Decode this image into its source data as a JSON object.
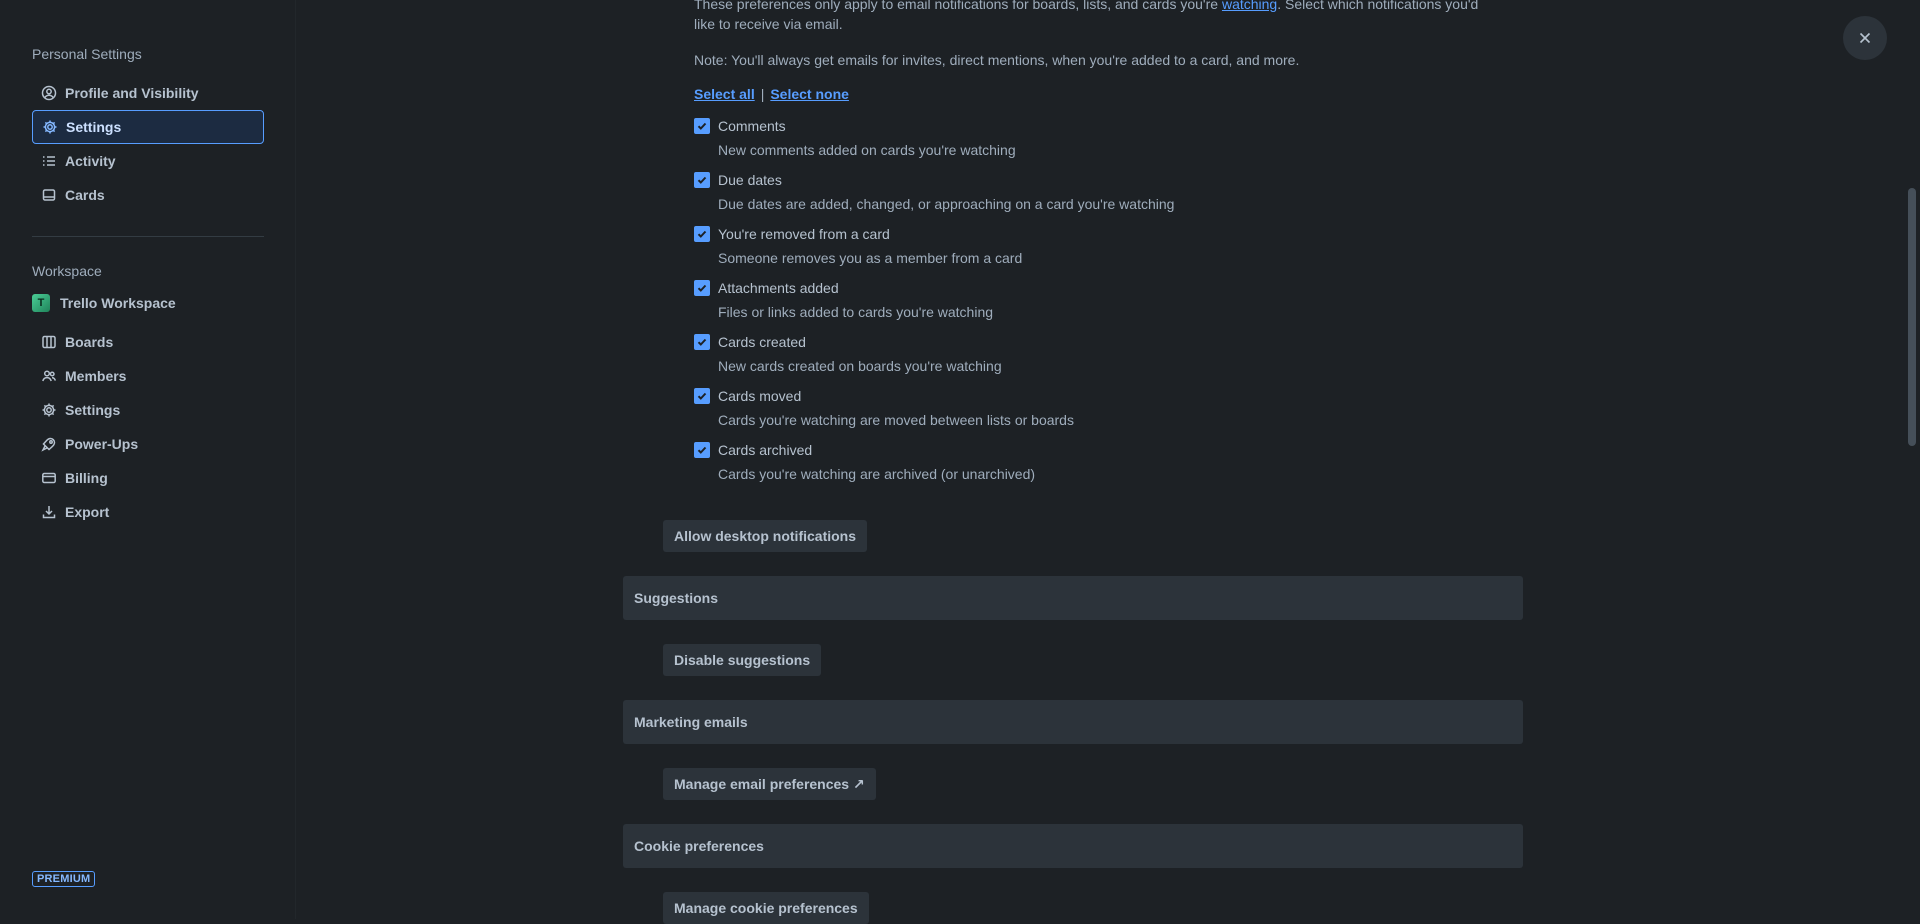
{
  "sidebar": {
    "personal_title": "Personal Settings",
    "personal_items": [
      {
        "label": "Profile and Visibility",
        "icon": "profile-icon"
      },
      {
        "label": "Settings",
        "icon": "gear-icon",
        "active": true
      },
      {
        "label": "Activity",
        "icon": "activity-list-icon"
      },
      {
        "label": "Cards",
        "icon": "card-icon"
      }
    ],
    "workspace_title": "Workspace",
    "workspace_name": "Trello Workspace",
    "workspace_avatar_letter": "T",
    "workspace_items": [
      {
        "label": "Boards",
        "icon": "boards-icon"
      },
      {
        "label": "Members",
        "icon": "members-icon"
      },
      {
        "label": "Settings",
        "icon": "gear-icon"
      },
      {
        "label": "Power-Ups",
        "icon": "rocket-icon"
      },
      {
        "label": "Billing",
        "icon": "billing-card-icon"
      },
      {
        "label": "Export",
        "icon": "export-icon"
      }
    ],
    "premium_badge": "PREMIUM"
  },
  "main": {
    "intro_line1_prefix": "These preferences only apply to email notifications for boards, lists, and cards you're ",
    "intro_link": "watching",
    "intro_line1_suffix": ". Select which notifications you'd",
    "intro_line2": "like to receive via email.",
    "note": "Note: You'll always get emails for invites, direct mentions, when you're added to a card, and more.",
    "select_all": "Select all",
    "separator": "|",
    "select_none": "Select none",
    "notifications": [
      {
        "title": "Comments",
        "desc": "New comments added on cards you're watching",
        "checked": true
      },
      {
        "title": "Due dates",
        "desc": "Due dates are added, changed, or approaching on a card you're watching",
        "checked": true
      },
      {
        "title": "You're removed from a card",
        "desc": "Someone removes you as a member from a card",
        "checked": true
      },
      {
        "title": "Attachments added",
        "desc": "Files or links added to cards you're watching",
        "checked": true
      },
      {
        "title": "Cards created",
        "desc": "New cards created on boards you're watching",
        "checked": true
      },
      {
        "title": "Cards moved",
        "desc": "Cards you're watching are moved between lists or boards",
        "checked": true
      },
      {
        "title": "Cards archived",
        "desc": "Cards you're watching are archived (or unarchived)",
        "checked": true
      }
    ],
    "desktop_button": "Allow desktop notifications",
    "suggestions_title": "Suggestions",
    "disable_suggestions_button": "Disable suggestions",
    "marketing_title": "Marketing emails",
    "manage_email_button": "Manage email preferences ↗",
    "cookie_title": "Cookie preferences",
    "manage_cookie_button": "Manage cookie preferences"
  },
  "colors": {
    "background": "#1d2125",
    "accent": "#579dff",
    "section_bg": "#2c333a"
  }
}
